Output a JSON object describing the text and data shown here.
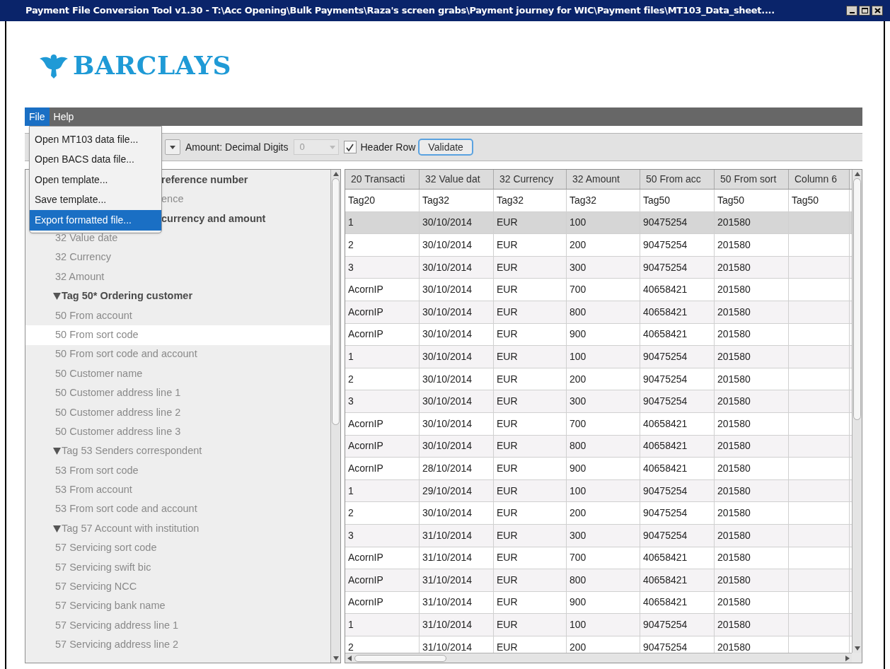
{
  "window": {
    "title": "Payment File Conversion Tool v1.30 - T:\\Acc Opening\\Bulk Payments\\Raza's screen grabs\\Payment journey for WIC\\Payment files\\MT103_Data_sheet...."
  },
  "logo": {
    "text": "BARCLAYS"
  },
  "menu_bar": [
    {
      "label": "File",
      "selected": true
    },
    {
      "label": "Help",
      "selected": false
    }
  ],
  "file_menu": [
    {
      "label": "Open MT103 data file...",
      "selected": false
    },
    {
      "label": "Open BACS data file...",
      "selected": false
    },
    {
      "label": "Open template...",
      "selected": false
    },
    {
      "label": "Save template...",
      "selected": false
    },
    {
      "label": "Export formatted file...",
      "selected": true
    }
  ],
  "toolbar": {
    "decimal_label": "Amount: Decimal Digits",
    "decimal_value": "0",
    "decimal_disabled": true,
    "header_row": {
      "label": "Header Row",
      "checked": true
    },
    "validate": "Validate"
  },
  "tree": [
    {
      "label": "reference number",
      "partial": true,
      "bold": true,
      "expanded": true,
      "children": [
        {
          "label": "ence",
          "partial": true,
          "selected": false
        }
      ]
    },
    {
      "label": "currency and amount",
      "partial": true,
      "bold": true,
      "expanded": true,
      "children": [
        {
          "label": "32 Value date",
          "partial": false,
          "selected": false
        },
        {
          "label": "32 Currency",
          "partial": false,
          "selected": false
        },
        {
          "label": "32 Amount",
          "partial": false,
          "selected": false
        }
      ]
    },
    {
      "label": "Tag 50* Ordering customer",
      "partial": false,
      "bold": true,
      "expanded": true,
      "children": [
        {
          "label": "50 From account",
          "partial": false,
          "selected": false
        },
        {
          "label": "50 From sort code",
          "partial": false,
          "selected": true
        },
        {
          "label": "50 From sort code and account",
          "partial": false,
          "selected": false
        },
        {
          "label": "50 Customer name",
          "partial": false,
          "selected": false
        },
        {
          "label": "50 Customer address line 1",
          "partial": false,
          "selected": false
        },
        {
          "label": "50 Customer address line 2",
          "partial": false,
          "selected": false
        },
        {
          "label": "50 Customer address line 3",
          "partial": false,
          "selected": false
        }
      ]
    },
    {
      "label": "Tag 53 Senders correspondent",
      "partial": false,
      "bold": false,
      "expanded": true,
      "children": [
        {
          "label": "53 From sort code",
          "partial": false,
          "selected": false
        },
        {
          "label": "53 From account",
          "partial": false,
          "selected": false
        },
        {
          "label": "53 From sort code and account",
          "partial": false,
          "selected": false
        }
      ]
    },
    {
      "label": "Tag 57 Account with institution",
      "partial": false,
      "bold": false,
      "expanded": true,
      "children": [
        {
          "label": "57 Servicing sort code",
          "partial": false,
          "selected": false
        },
        {
          "label": "57 Servicing swift bic",
          "partial": false,
          "selected": false
        },
        {
          "label": "57 Servicing NCC",
          "partial": false,
          "selected": false
        },
        {
          "label": "57 Servicing bank name",
          "partial": false,
          "selected": false
        },
        {
          "label": "57 Servicing address line 1",
          "partial": false,
          "selected": false
        },
        {
          "label": "57 Servicing address line 2",
          "partial": false,
          "selected": false
        }
      ]
    }
  ],
  "table": {
    "columns": [
      "20 Transacti",
      "32 Value dat",
      "32 Currency",
      "32 Amount",
      "50 From acc",
      "50 From sort",
      "Column 6"
    ],
    "rows": [
      {
        "cells": [
          "Tag20",
          "Tag32",
          "Tag32",
          "Tag32",
          "Tag50",
          "Tag50",
          "Tag50"
        ],
        "selected": false
      },
      {
        "cells": [
          "1",
          "30/10/2014",
          "EUR",
          "100",
          "90475254",
          "201580"
        ],
        "selected": true
      },
      {
        "cells": [
          "2",
          "30/10/2014",
          "EUR",
          "200",
          "90475254",
          "201580"
        ],
        "selected": false
      },
      {
        "cells": [
          "3",
          "30/10/2014",
          "EUR",
          "300",
          "90475254",
          "201580"
        ],
        "selected": false
      },
      {
        "cells": [
          "AcornIP",
          "30/10/2014",
          "EUR",
          "700",
          "40658421",
          "201580"
        ],
        "selected": false
      },
      {
        "cells": [
          "AcornIP",
          "30/10/2014",
          "EUR",
          "800",
          "40658421",
          "201580"
        ],
        "selected": false
      },
      {
        "cells": [
          "AcornIP",
          "30/10/2014",
          "EUR",
          "900",
          "40658421",
          "201580"
        ],
        "selected": false
      },
      {
        "cells": [
          "1",
          "30/10/2014",
          "EUR",
          "100",
          "90475254",
          "201580"
        ],
        "selected": false
      },
      {
        "cells": [
          "2",
          "30/10/2014",
          "EUR",
          "200",
          "90475254",
          "201580"
        ],
        "selected": false
      },
      {
        "cells": [
          "3",
          "30/10/2014",
          "EUR",
          "300",
          "90475254",
          "201580"
        ],
        "selected": false
      },
      {
        "cells": [
          "AcornIP",
          "30/10/2014",
          "EUR",
          "700",
          "40658421",
          "201580"
        ],
        "selected": false
      },
      {
        "cells": [
          "AcornIP",
          "30/10/2014",
          "EUR",
          "800",
          "40658421",
          "201580"
        ],
        "selected": false
      },
      {
        "cells": [
          "AcornIP",
          "28/10/2014",
          "EUR",
          "900",
          "40658421",
          "201580"
        ],
        "selected": false
      },
      {
        "cells": [
          "1",
          "29/10/2014",
          "EUR",
          "100",
          "90475254",
          "201580"
        ],
        "selected": false
      },
      {
        "cells": [
          "2",
          "30/10/2014",
          "EUR",
          "200",
          "90475254",
          "201580"
        ],
        "selected": false
      },
      {
        "cells": [
          "3",
          "31/10/2014",
          "EUR",
          "300",
          "90475254",
          "201580"
        ],
        "selected": false
      },
      {
        "cells": [
          "AcornIP",
          "31/10/2014",
          "EUR",
          "700",
          "40658421",
          "201580"
        ],
        "selected": false
      },
      {
        "cells": [
          "AcornIP",
          "31/10/2014",
          "EUR",
          "800",
          "40658421",
          "201580"
        ],
        "selected": false
      },
      {
        "cells": [
          "AcornIP",
          "31/10/2014",
          "EUR",
          "900",
          "40658421",
          "201580"
        ],
        "selected": false
      },
      {
        "cells": [
          "1",
          "31/10/2014",
          "EUR",
          "100",
          "90475254",
          "201580"
        ],
        "selected": false
      },
      {
        "cells": [
          "2",
          "31/10/2014",
          "EUR",
          "200",
          "90475254",
          "201580"
        ],
        "selected": false
      }
    ]
  }
}
